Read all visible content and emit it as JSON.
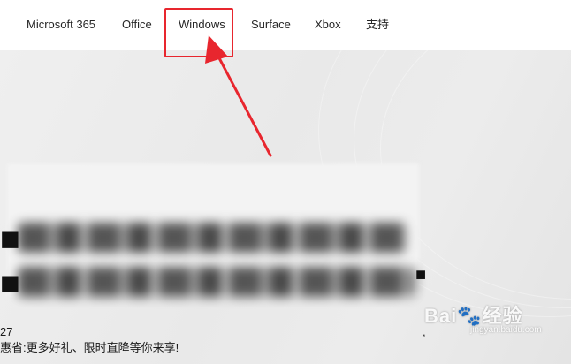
{
  "nav": {
    "items": [
      {
        "label": "Microsoft 365"
      },
      {
        "label": "Office"
      },
      {
        "label": "Windows"
      },
      {
        "label": "Surface"
      },
      {
        "label": "Xbox"
      },
      {
        "label": "支持"
      }
    ],
    "highlighted_item": "Windows"
  },
  "hero": {
    "partial_text_line": "惠省:更多好礼、限时直降等你来享!",
    "left_edge_digits": "27",
    "trailing_comma": ","
  },
  "annotation": {
    "color": "#e8262e",
    "arrow_icon": "red-arrow-icon"
  },
  "watermark": {
    "brand": "Bai🐾经验",
    "url": "jingyan.baidu.com"
  }
}
